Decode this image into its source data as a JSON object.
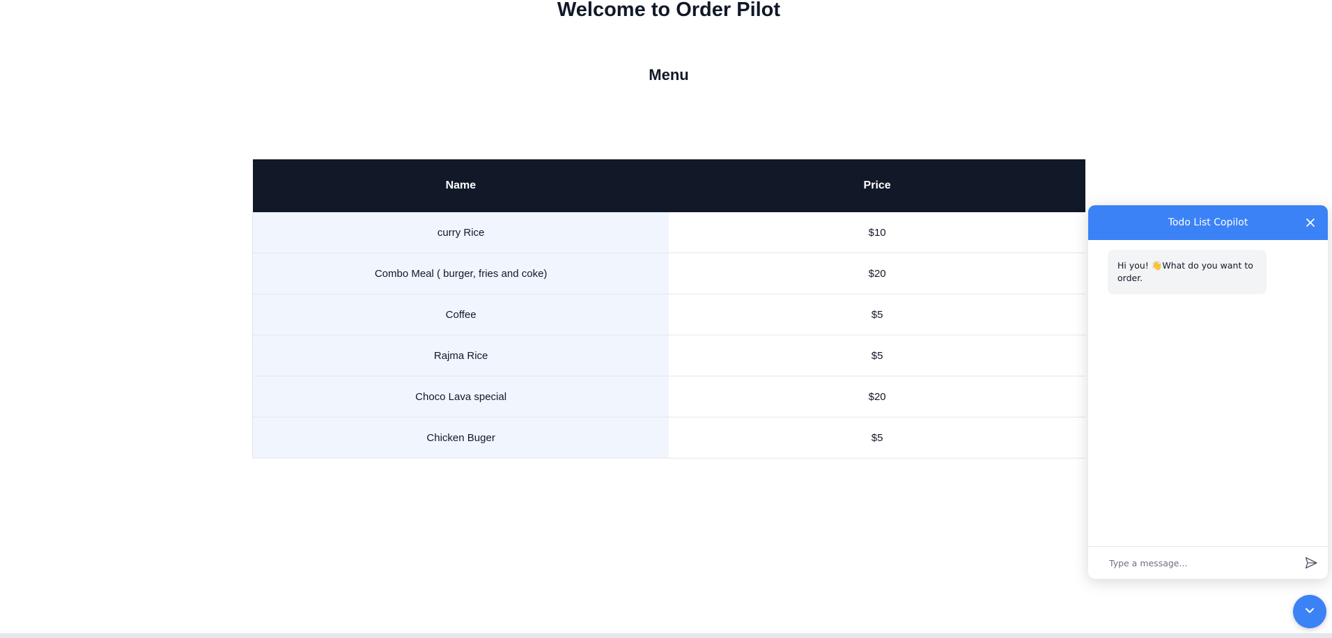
{
  "page": {
    "title": "Welcome to Order Pilot",
    "menu_heading": "Menu"
  },
  "menu": {
    "columns": [
      "Name",
      "Price"
    ],
    "items": [
      {
        "name": "curry Rice",
        "price": "$10"
      },
      {
        "name": "Combo Meal ( burger, fries and coke)",
        "price": "$20"
      },
      {
        "name": "Coffee",
        "price": "$5"
      },
      {
        "name": "Rajma Rice",
        "price": "$5"
      },
      {
        "name": "Choco Lava special",
        "price": "$20"
      },
      {
        "name": "Chicken Buger",
        "price": "$5"
      }
    ]
  },
  "chat": {
    "title": "Todo List Copilot",
    "messages": [
      {
        "role": "assistant",
        "text": "Hi you! 👋What do you want to order."
      }
    ],
    "input_placeholder": "Type a message...",
    "close_icon": "close-icon",
    "send_icon": "send-icon",
    "toggle_icon": "chevron-down-icon"
  },
  "colors": {
    "header_dark": "#111827",
    "accent": "#3b82f6",
    "name_col_bg": "#f1f5fd"
  }
}
